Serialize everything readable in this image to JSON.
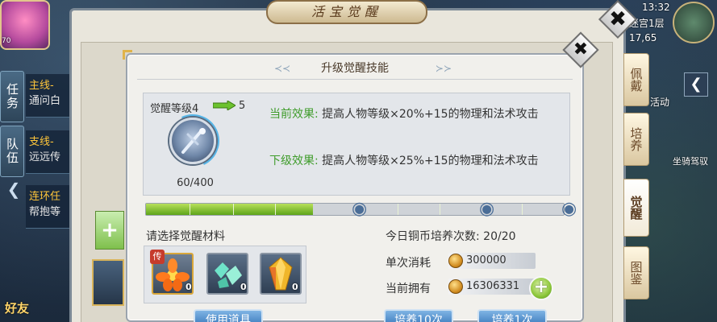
{
  "hud": {
    "avatar_level": "70",
    "tabs_left": [
      "任务",
      "队伍"
    ],
    "quests": [
      {
        "type": "主线-",
        "desc": "通问白"
      },
      {
        "type": "支线-",
        "desc": "远远传"
      },
      {
        "type": "连环任",
        "desc": "帮抱等"
      }
    ],
    "friends_label": "好友",
    "clock": "13:32",
    "location": "迷宫1层",
    "coords": "17,65",
    "right_icon_labels": [
      "活动",
      "坐骑驾驭"
    ],
    "right_tabs": [
      "佩戴",
      "培养",
      "觉醒",
      "图鉴"
    ],
    "active_right_tab": "觉醒"
  },
  "back_panel": {
    "title": "活宝觉醒"
  },
  "dialog": {
    "title": "升级觉醒技能",
    "current_level": "觉醒等级4",
    "next_level": "5",
    "skill_progress": "60/400",
    "current_effect_label": "当前效果:",
    "current_effect_text": "提高人物等级×20%+15的物理和法术攻击",
    "next_effect_label": "下级效果:",
    "next_effect_text": "提高人物等级×25%+15的物理和法术攻击",
    "progress_fraction": 0.4,
    "material_title": "请选择觉醒材料",
    "materials": [
      {
        "icon": "flower-icon",
        "qty": "0",
        "tag": "传"
      },
      {
        "icon": "jade-icon",
        "qty": "0"
      },
      {
        "icon": "crystal-icon",
        "qty": "0"
      }
    ],
    "cultivation_title": "今日铜币培养次数: 20/20",
    "single_cost_label": "单次消耗",
    "single_cost_value": "300000",
    "owned_label": "当前拥有",
    "owned_value": "16306331",
    "use_item_button": "使用道具",
    "cultivate_10_button": "培养10次",
    "cultivate_1_button": "培养1次"
  },
  "colors": {
    "effect_label": "#3f9c2b",
    "progress_fill": "#7cc22a",
    "button_blue": "#3d7bbd"
  }
}
